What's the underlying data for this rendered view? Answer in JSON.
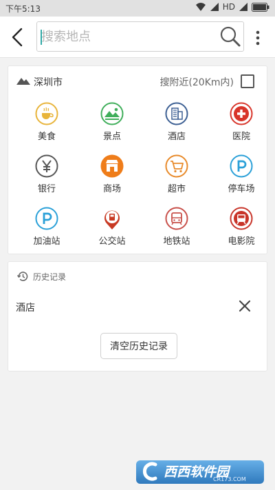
{
  "status_bar": {
    "time": "下午5:13",
    "network": "HD"
  },
  "header": {
    "search_placeholder": "搜索地点"
  },
  "city": {
    "name": "深圳市",
    "nearby_label": "搜附近(20Km内)"
  },
  "categories": [
    {
      "label": "美食",
      "icon": "food-icon",
      "color": "#e8b43a"
    },
    {
      "label": "景点",
      "icon": "scenery-icon",
      "color": "#3fae5a"
    },
    {
      "label": "酒店",
      "icon": "hotel-icon",
      "color": "#3c5f93"
    },
    {
      "label": "医院",
      "icon": "hospital-icon",
      "color": "#d8352a"
    },
    {
      "label": "银行",
      "icon": "bank-icon",
      "color": "#555555"
    },
    {
      "label": "商场",
      "icon": "mall-icon",
      "color": "#ef7d1a"
    },
    {
      "label": "超市",
      "icon": "supermarket-icon",
      "color": "#e88a2a"
    },
    {
      "label": "停车场",
      "icon": "parking-icon",
      "color": "#2aa0d8"
    },
    {
      "label": "加油站",
      "icon": "gas-station-icon",
      "color": "#2aa0d8"
    },
    {
      "label": "公交站",
      "icon": "bus-stop-icon",
      "color": "#c83a24"
    },
    {
      "label": "地铁站",
      "icon": "subway-icon",
      "color": "#c8504a"
    },
    {
      "label": "电影院",
      "icon": "cinema-icon",
      "color": "#c8352a"
    }
  ],
  "history": {
    "title": "历史记录",
    "items": [
      "酒店"
    ],
    "clear_label": "清空历史记录"
  },
  "watermark": {
    "text": "西西软件园",
    "sub": "CR173.COM"
  }
}
